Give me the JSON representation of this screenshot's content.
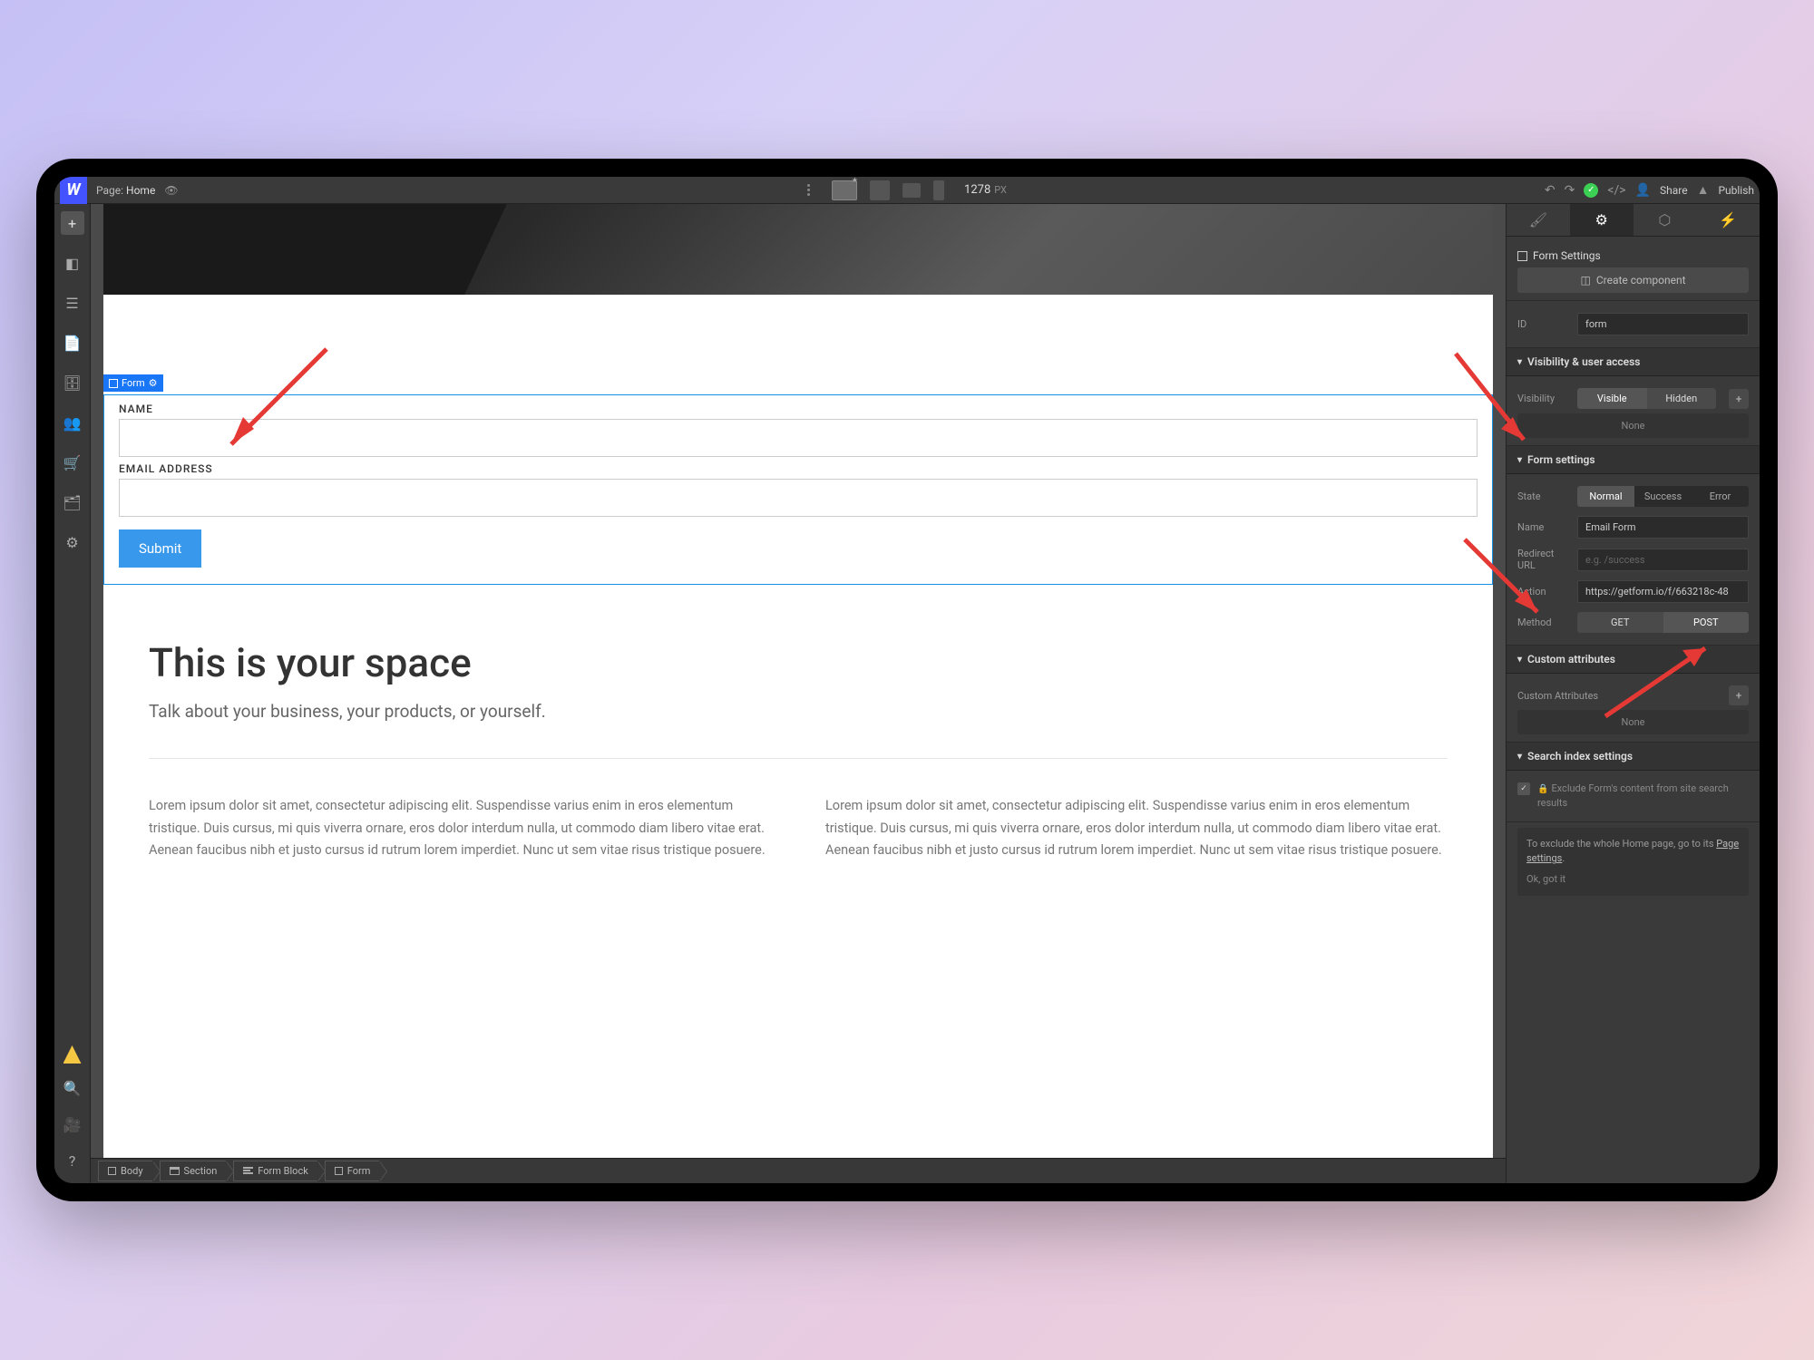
{
  "topbar": {
    "page_label": "Page:",
    "page_name": "Home",
    "width_value": "1278",
    "width_unit": "PX",
    "share": "Share",
    "publish": "Publish"
  },
  "form_selection": {
    "tag": "Form"
  },
  "form": {
    "name_label": "NAME",
    "email_label": "EMAIL ADDRESS",
    "submit": "Submit"
  },
  "content": {
    "heading": "This is your space",
    "subtitle": "Talk about your business, your products, or yourself.",
    "lorem": "Lorem ipsum dolor sit amet, consectetur adipiscing elit. Suspendisse varius enim in eros elementum tristique. Duis cursus, mi quis viverra ornare, eros dolor interdum nulla, ut commodo diam libero vitae erat. Aenean faucibus nibh et justo cursus id rutrum lorem imperdiet. Nunc ut sem vitae risus tristique posuere."
  },
  "breadcrumb": {
    "body": "Body",
    "section": "Section",
    "form_block": "Form Block",
    "form": "Form"
  },
  "rightpanel": {
    "form_settings_title": "Form Settings",
    "create_component": "Create component",
    "id_label": "ID",
    "id_value": "form",
    "visibility_section": "Visibility & user access",
    "visibility_label": "Visibility",
    "visible": "Visible",
    "hidden": "Hidden",
    "none": "None",
    "form_settings_section": "Form settings",
    "state_label": "State",
    "state_normal": "Normal",
    "state_success": "Success",
    "state_error": "Error",
    "name_label": "Name",
    "name_value": "Email Form",
    "redirect_label": "Redirect URL",
    "redirect_placeholder": "e.g. /success",
    "action_label": "Action",
    "action_value": "https://getform.io/f/663218c-48",
    "method_label": "Method",
    "method_get": "GET",
    "method_post": "POST",
    "custom_attr_section": "Custom attributes",
    "custom_attr_label": "Custom Attributes",
    "search_index_section": "Search index settings",
    "exclude_text": "Exclude Form's content from site search results",
    "hint_text": "To exclude the whole Home page, go to its ",
    "hint_link": "Page settings",
    "hint_dot": ".",
    "ok_got_it": "Ok, got it"
  }
}
